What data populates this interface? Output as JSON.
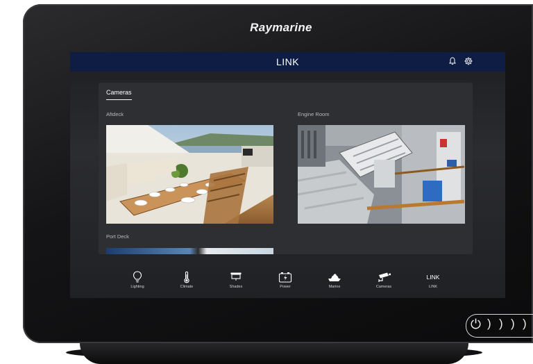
{
  "device": {
    "brand": "Raymarine",
    "power_glyph": "⏻",
    "arrow_glyphs": [
      ")",
      ")",
      ")",
      ")"
    ]
  },
  "topbar": {
    "title": "LINK",
    "icons": [
      "bell-icon",
      "gear-icon"
    ]
  },
  "tabs": [
    {
      "label": "Cameras",
      "active": true
    }
  ],
  "cameras": [
    {
      "label": "Aftdeck"
    },
    {
      "label": "Engine Room"
    },
    {
      "label": "Port Deck"
    }
  ],
  "nav": [
    {
      "label": "Lighting",
      "icon": "lightbulb-icon"
    },
    {
      "label": "Climate",
      "icon": "thermometer-icon"
    },
    {
      "label": "Shades",
      "icon": "shades-icon"
    },
    {
      "label": "Power",
      "icon": "battery-icon"
    },
    {
      "label": "Marine",
      "icon": "boat-icon"
    },
    {
      "label": "Cameras",
      "icon": "camera-icon",
      "active": true
    },
    {
      "label": "LINK",
      "icon_text": "LINK"
    }
  ],
  "colors": {
    "topbar": "#0f1d44",
    "panel": "#2e2f33",
    "accent": "#ffffff"
  }
}
